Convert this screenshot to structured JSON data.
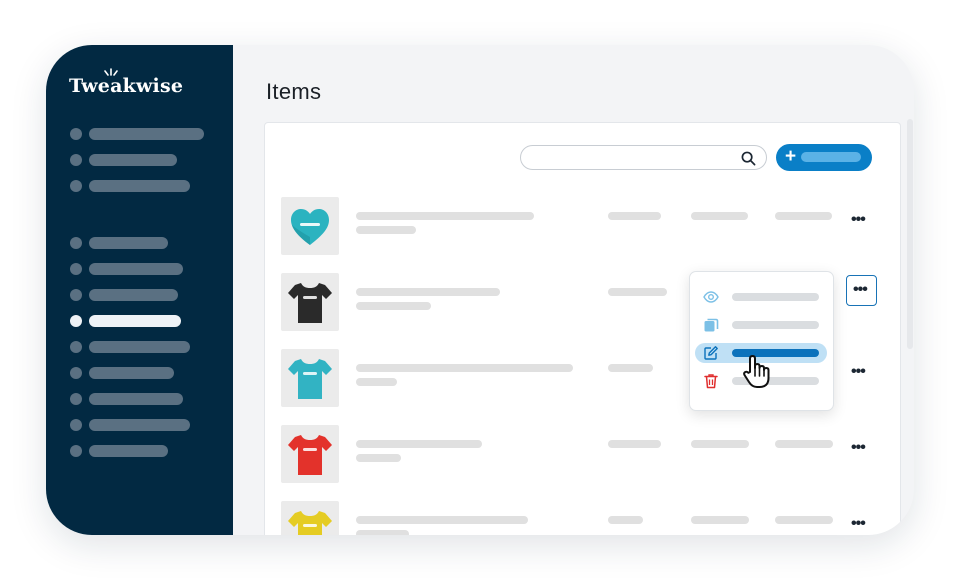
{
  "app": {
    "logo_text": "Tweakwise"
  },
  "sidebar": {
    "items": [
      {
        "name": "nav-item-1",
        "active": false
      },
      {
        "name": "nav-item-2",
        "active": false
      },
      {
        "name": "nav-item-3",
        "active": false
      },
      {
        "name": "nav-item-4",
        "active": false
      },
      {
        "name": "nav-item-5",
        "active": false
      },
      {
        "name": "nav-item-6",
        "active": false
      },
      {
        "name": "nav-item-7",
        "active": true
      },
      {
        "name": "nav-item-8",
        "active": false
      },
      {
        "name": "nav-item-9",
        "active": false
      },
      {
        "name": "nav-item-10",
        "active": false
      },
      {
        "name": "nav-item-11",
        "active": false
      },
      {
        "name": "nav-item-12",
        "active": false
      }
    ]
  },
  "main": {
    "title": "Items",
    "search": {
      "value": "",
      "placeholder": "",
      "icon": "search-icon"
    },
    "add_button": {
      "icon": "plus-icon",
      "label": ""
    },
    "items": [
      {
        "product": "heart pillow",
        "color": "#2bb3c0",
        "print": "Tweakwise"
      },
      {
        "product": "t-shirt",
        "color": "#2a2a2a",
        "print": "Tweakwise"
      },
      {
        "product": "t-shirt",
        "color": "#32b3c3",
        "print": "Tweakwise"
      },
      {
        "product": "t-shirt",
        "color": "#e3322b",
        "print": "Tweakwise"
      },
      {
        "product": "t-shirt",
        "color": "#e5cc23",
        "print": "Tweakwise"
      }
    ],
    "row_menu": {
      "open_on_row": 2,
      "items": [
        {
          "action": "view",
          "icon": "eye-icon"
        },
        {
          "action": "duplicate",
          "icon": "copy-icon"
        },
        {
          "action": "edit",
          "icon": "edit-icon",
          "highlighted": true
        },
        {
          "action": "delete",
          "icon": "trash-icon"
        }
      ]
    }
  },
  "colors": {
    "sidebar_bg": "#022942",
    "accent": "#0a7fc7",
    "highlight": "#bfe0f5",
    "danger": "#e02f2f",
    "menu_icon": "#7cc0e6"
  }
}
